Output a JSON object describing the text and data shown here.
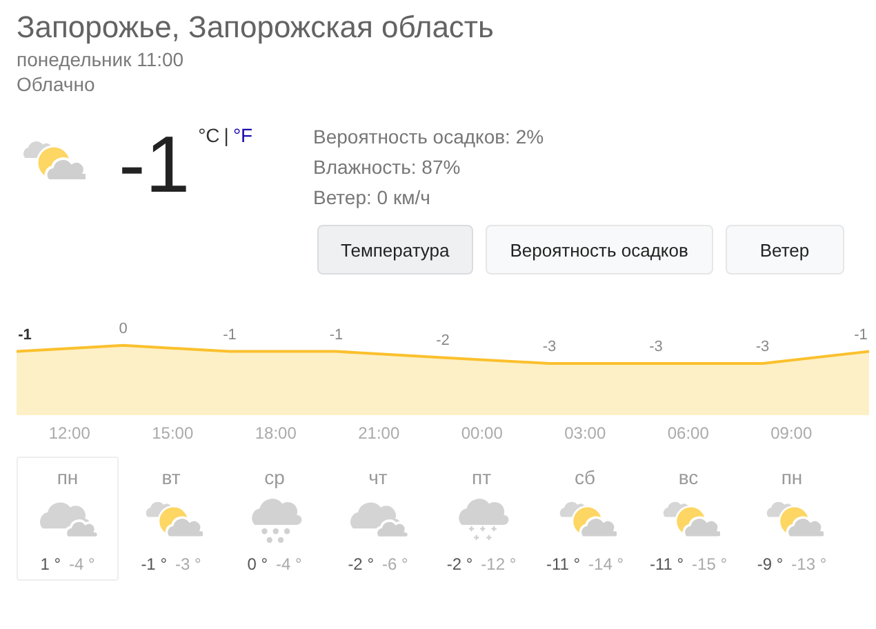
{
  "location": "Запорожье, Запорожская область",
  "time": "понедельник 11:00",
  "condition": "Облачно",
  "current": {
    "kind": "sun_cloud",
    "temperature": "-1",
    "units": [
      {
        "label": "°C",
        "selected": true
      },
      {
        "label": "°F",
        "selected": false
      }
    ],
    "separator": "|"
  },
  "details": [
    "Вероятность осадков: 2%",
    "Влажность: 87%",
    "Ветер: 0 км/ч"
  ],
  "tabs": [
    {
      "label": "Температура",
      "selected": true
    },
    {
      "label": "Вероятность осадков",
      "selected": false
    },
    {
      "label": "Ветер",
      "selected": false
    }
  ],
  "chart_data": {
    "type": "line",
    "categories": [
      null,
      null,
      null,
      null,
      null,
      null,
      null,
      null,
      null
    ],
    "series": [
      {
        "color": "#fbc02d",
        "values": [
          -1,
          0,
          -1,
          -1,
          -2,
          -3,
          -3,
          -3,
          -1
        ]
      }
    ],
    "data_labels": true
  },
  "time_labels": [
    "12:00",
    "15:00",
    "18:00",
    "21:00",
    "00:00",
    "03:00",
    "06:00",
    "09:00"
  ],
  "days": [
    {
      "name": "пн",
      "kind": "cloudy",
      "high": "1 °",
      "low": "-4 °",
      "selected": true
    },
    {
      "name": "вт",
      "kind": "sun_cloud",
      "high": "-1 °",
      "low": "-3 °",
      "selected": false
    },
    {
      "name": "ср",
      "kind": "snow",
      "high": "0 °",
      "low": "-4 °",
      "selected": false
    },
    {
      "name": "чт",
      "kind": "cloudy",
      "high": "-2 °",
      "low": "-6 °",
      "selected": false
    },
    {
      "name": "пт",
      "kind": "flurries",
      "high": "-2 °",
      "low": "-12 °",
      "selected": false
    },
    {
      "name": "сб",
      "kind": "sun_cloud",
      "high": "-11 °",
      "low": "-14 °",
      "selected": false
    },
    {
      "name": "вс",
      "kind": "sun_cloud",
      "high": "-11 °",
      "low": "-15 °",
      "selected": false
    },
    {
      "name": "пн",
      "kind": "sun_cloud",
      "high": "-9 °",
      "low": "-13 °",
      "selected": false
    }
  ]
}
